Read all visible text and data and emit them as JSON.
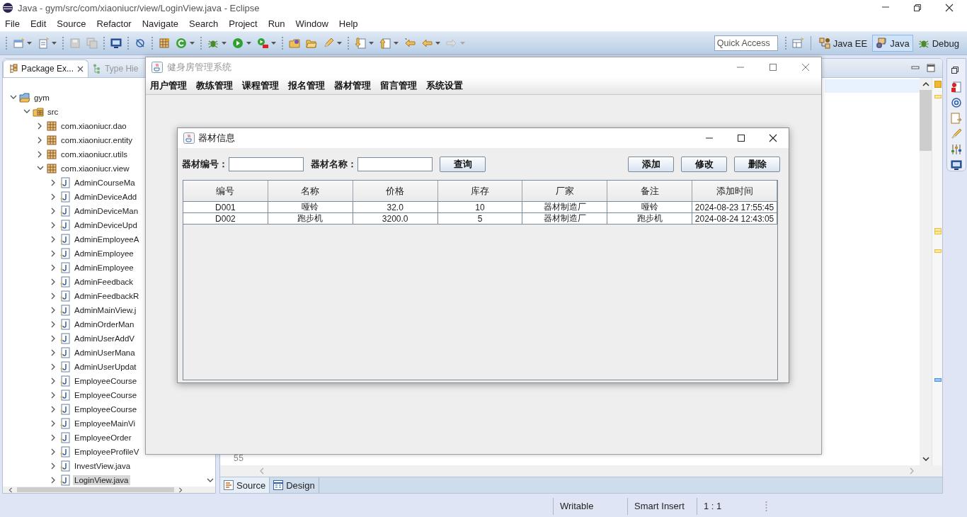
{
  "window": {
    "title": "Java - gym/src/com/xiaoniucr/view/LoginView.java - Eclipse"
  },
  "menu": [
    "File",
    "Edit",
    "Source",
    "Refactor",
    "Navigate",
    "Search",
    "Project",
    "Run",
    "Window",
    "Help"
  ],
  "toolbar": {
    "quick_access": {
      "placeholder": "Quick Access"
    },
    "perspectives": [
      {
        "label": "Java EE",
        "selected": false
      },
      {
        "label": "Java",
        "selected": true
      },
      {
        "label": "Debug",
        "selected": false
      }
    ]
  },
  "package_explorer": {
    "tabs": [
      {
        "label": "Package Ex...",
        "selected": true
      },
      {
        "label": "Type Hie",
        "selected": false
      }
    ],
    "tree": [
      {
        "label": "gym",
        "kind": "project",
        "expanded": true,
        "selected": false,
        "children": [
          {
            "label": "src",
            "kind": "source",
            "expanded": true,
            "selected": false,
            "children": [
              {
                "label": "com.xiaoniucr.dao",
                "kind": "package",
                "expanded": false,
                "selected": false
              },
              {
                "label": "com.xiaoniucr.entity",
                "kind": "package",
                "expanded": false,
                "selected": false
              },
              {
                "label": "com.xiaoniucr.utils",
                "kind": "package",
                "expanded": false,
                "selected": false
              },
              {
                "label": "com.xiaoniucr.view",
                "kind": "package",
                "expanded": true,
                "selected": false,
                "children": [
                  {
                    "label": "AdminCourseMa",
                    "kind": "file",
                    "expanded": false,
                    "selected": false
                  },
                  {
                    "label": "AdminDeviceAdd",
                    "kind": "file",
                    "expanded": false,
                    "selected": false
                  },
                  {
                    "label": "AdminDeviceMan",
                    "kind": "file",
                    "expanded": false,
                    "selected": false
                  },
                  {
                    "label": "AdminDeviceUpd",
                    "kind": "file",
                    "expanded": false,
                    "selected": false
                  },
                  {
                    "label": "AdminEmployeeA",
                    "kind": "file",
                    "expanded": false,
                    "selected": false
                  },
                  {
                    "label": "AdminEmployee",
                    "kind": "file",
                    "expanded": false,
                    "selected": false
                  },
                  {
                    "label": "AdminEmployee",
                    "kind": "file",
                    "expanded": false,
                    "selected": false
                  },
                  {
                    "label": "AdminFeedback",
                    "kind": "file",
                    "expanded": false,
                    "selected": false
                  },
                  {
                    "label": "AdminFeedbackR",
                    "kind": "file",
                    "expanded": false,
                    "selected": false
                  },
                  {
                    "label": "AdminMainView.j",
                    "kind": "file",
                    "expanded": false,
                    "selected": false
                  },
                  {
                    "label": "AdminOrderMan",
                    "kind": "file",
                    "expanded": false,
                    "selected": false
                  },
                  {
                    "label": "AdminUserAddV",
                    "kind": "file",
                    "expanded": false,
                    "selected": false
                  },
                  {
                    "label": "AdminUserMana",
                    "kind": "file",
                    "expanded": false,
                    "selected": false
                  },
                  {
                    "label": "AdminUserUpdat",
                    "kind": "file",
                    "expanded": false,
                    "selected": false
                  },
                  {
                    "label": "EmployeeCourse",
                    "kind": "file",
                    "expanded": false,
                    "selected": false
                  },
                  {
                    "label": "EmployeeCourse",
                    "kind": "file",
                    "expanded": false,
                    "selected": false
                  },
                  {
                    "label": "EmployeeCourse",
                    "kind": "file",
                    "expanded": false,
                    "selected": false
                  },
                  {
                    "label": "EmployeeMainVi",
                    "kind": "file",
                    "expanded": false,
                    "selected": false
                  },
                  {
                    "label": "EmployeeOrder",
                    "kind": "file",
                    "expanded": false,
                    "selected": false
                  },
                  {
                    "label": "EmployeeProfileV",
                    "kind": "file",
                    "expanded": false,
                    "selected": false
                  },
                  {
                    "label": "InvestView.java",
                    "kind": "file",
                    "expanded": false,
                    "selected": false
                  },
                  {
                    "label": "LoginView.java",
                    "kind": "file",
                    "expanded": false,
                    "selected": true
                  }
                ]
              }
            ]
          }
        ]
      }
    ]
  },
  "editor": {
    "line_number": "55",
    "tabs": [
      {
        "label": "Source",
        "selected": true
      },
      {
        "label": "Design",
        "selected": false
      }
    ]
  },
  "status_bar": [
    "Writable",
    "Smart Insert",
    "1 : 1"
  ],
  "app_window": {
    "title": "健身房管理系统",
    "menu": [
      "用户管理",
      "教练管理",
      "课程管理",
      "报名管理",
      "器材管理",
      "留言管理",
      "系统设置"
    ]
  },
  "dialog": {
    "title": "器材信息",
    "filters": [
      {
        "label": "器材编号："
      },
      {
        "label": "器材名称："
      }
    ],
    "search_button": "查询",
    "actions": [
      "添加",
      "修改",
      "删除"
    ],
    "table": {
      "columns": [
        "编号",
        "名称",
        "价格",
        "库存",
        "厂家",
        "备注",
        "添加时间"
      ],
      "rows": [
        [
          "D001",
          "哑铃",
          "32.0",
          "10",
          "器材制造厂",
          "哑铃",
          "2024-08-23 17:55:45"
        ],
        [
          "D002",
          "跑步机",
          "3200.0",
          "5",
          "器材制造厂",
          "跑步机",
          "2024-08-24 12:43:05"
        ]
      ]
    }
  }
}
